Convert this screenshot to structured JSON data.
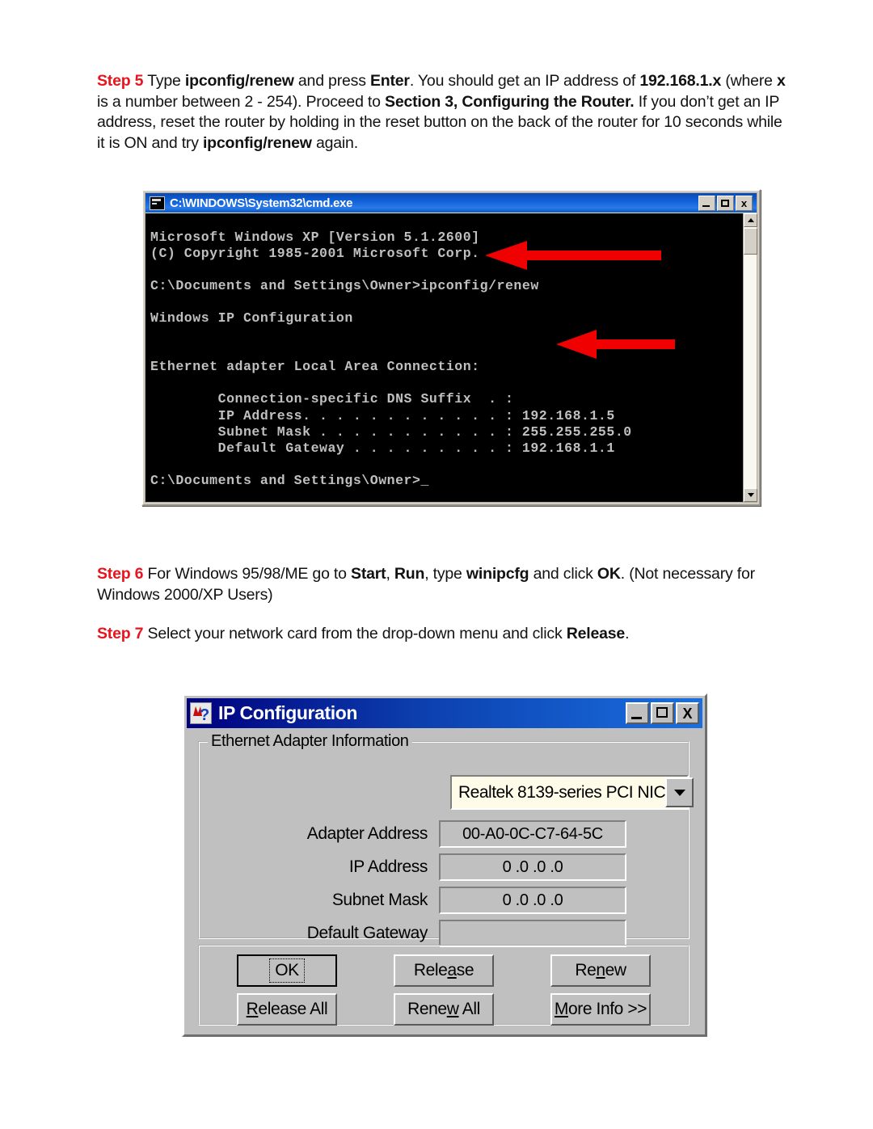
{
  "steps": {
    "step5": {
      "label": "Step 5",
      "segments": [
        {
          "t": " Type ",
          "b": false
        },
        {
          "t": "ipconfig/renew",
          "b": true
        },
        {
          "t": " and press ",
          "b": false
        },
        {
          "t": "Enter",
          "b": true
        },
        {
          "t": ". You should get an IP address of ",
          "b": false
        },
        {
          "t": "192.168.1.x",
          "b": true
        },
        {
          "t": " (where ",
          "b": false
        },
        {
          "t": "x",
          "b": true
        },
        {
          "t": " is a number between 2 - 254). Proceed to ",
          "b": false
        },
        {
          "t": "Section 3, Configuring the Router.",
          "b": true
        },
        {
          "t": " If you don’t get an IP address, reset the router by holding in the reset button on the back of the router for 10 seconds while it is ON and try ",
          "b": false
        },
        {
          "t": "ipconfig/renew",
          "b": true
        },
        {
          "t": " again.",
          "b": false
        }
      ]
    },
    "step6": {
      "label": "Step 6",
      "segments": [
        {
          "t": " For Windows 95/98/ME go to ",
          "b": false
        },
        {
          "t": "Start",
          "b": true
        },
        {
          "t": ", ",
          "b": false
        },
        {
          "t": "Run",
          "b": true
        },
        {
          "t": ", type ",
          "b": false
        },
        {
          "t": "winipcfg",
          "b": true
        },
        {
          "t": " and click ",
          "b": false
        },
        {
          "t": "OK",
          "b": true
        },
        {
          "t": ".  (Not necessary for Windows 2000/XP Users)",
          "b": false
        }
      ]
    },
    "step7": {
      "label": "Step 7",
      "segments": [
        {
          "t": " Select your network card from the drop-down menu and click ",
          "b": false
        },
        {
          "t": "Release",
          "b": true
        },
        {
          "t": ".",
          "b": false
        }
      ]
    }
  },
  "cmd_window": {
    "title": "C:\\WINDOWS\\System32\\cmd.exe",
    "icon": "cmd-icon",
    "buttons": {
      "minimize": "_",
      "maximize": "□",
      "close": "x"
    },
    "console_text": "Microsoft Windows XP [Version 5.1.2600]\n(C) Copyright 1985-2001 Microsoft Corp.\n\nC:\\Documents and Settings\\Owner>ipconfig/renew\n\nWindows IP Configuration\n\n\nEthernet adapter Local Area Connection:\n\n        Connection-specific DNS Suffix  . :\n        IP Address. . . . . . . . . . . . : 192.168.1.5\n        Subnet Mask . . . . . . . . . . . : 255.255.255.0\n        Default Gateway . . . . . . . . . : 192.168.1.1\n\nC:\\Documents and Settings\\Owner>_",
    "console_colors": {
      "background": "#000000",
      "text": "#c0c0c0"
    }
  },
  "annotations": {
    "arrow_color": "#f00000",
    "arrow1_target": "ipconfig/renew",
    "arrow2_target": "192.168.1.5"
  },
  "ipconfig_dialog": {
    "title": "IP Configuration",
    "icon": "question-mark-icon",
    "buttons": {
      "minimize": "_",
      "maximize": "□",
      "close": "X"
    },
    "group_legend": "Ethernet  Adapter Information",
    "adapter_select": {
      "value": "Realtek 8139-series PCI NIC",
      "arrow": "chevron-down-icon"
    },
    "fields": [
      {
        "label": "Adapter Address",
        "value": "00-A0-0C-C7-64-5C"
      },
      {
        "label": "IP Address",
        "value": "0 .0 .0 .0"
      },
      {
        "label": "Subnet Mask",
        "value": "0 .0 .0 .0"
      },
      {
        "label": "Default Gateway",
        "value": ""
      }
    ],
    "action_buttons": [
      {
        "name": "ok",
        "text": "OK",
        "accel": null,
        "default": true
      },
      {
        "name": "release",
        "text": "Release",
        "accel": "a",
        "default": false
      },
      {
        "name": "renew",
        "text": "Renew",
        "accel": "n",
        "default": false
      },
      {
        "name": "release-all",
        "text": "Release All",
        "accel": "R",
        "default": false
      },
      {
        "name": "renew-all",
        "text": "Renew All",
        "accel": "w",
        "default": false
      },
      {
        "name": "more-info",
        "text": "More Info >>",
        "accel": "M",
        "default": false
      }
    ]
  }
}
